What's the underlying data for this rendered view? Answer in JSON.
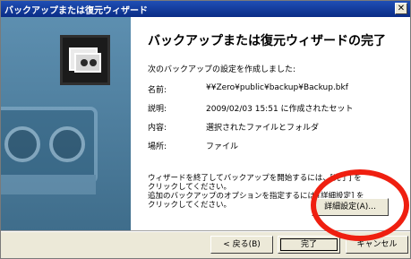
{
  "window": {
    "title": "バックアップまたは復元ウィザード",
    "close_glyph": "✕"
  },
  "wizard": {
    "heading": "バックアップまたは復元ウィザードの完了",
    "intro": "次のバックアップの設定を作成しました:",
    "rows": [
      {
        "label": "名前:",
        "value": "¥¥Zero¥public¥backup¥Backup.bkf"
      },
      {
        "label": "説明:",
        "value": "2009/02/03 15:51 に作成されたセット"
      },
      {
        "label": "内容:",
        "value": "選択されたファイルとフォルダ"
      },
      {
        "label": "場所:",
        "value": "ファイル"
      }
    ],
    "note": "ウィザードを終了してバックアップを開始するには、[完了] をクリックしてください。\n追加のバックアップのオプションを指定するには [詳細設定] をクリックしてください。",
    "advanced_button": "詳細設定(A)..."
  },
  "footer": {
    "back_button": "< 戻る(B)",
    "finish_button": "完了",
    "cancel_button": "キャンセル"
  },
  "annotation": {
    "highlight_color": "#ef1f10"
  }
}
